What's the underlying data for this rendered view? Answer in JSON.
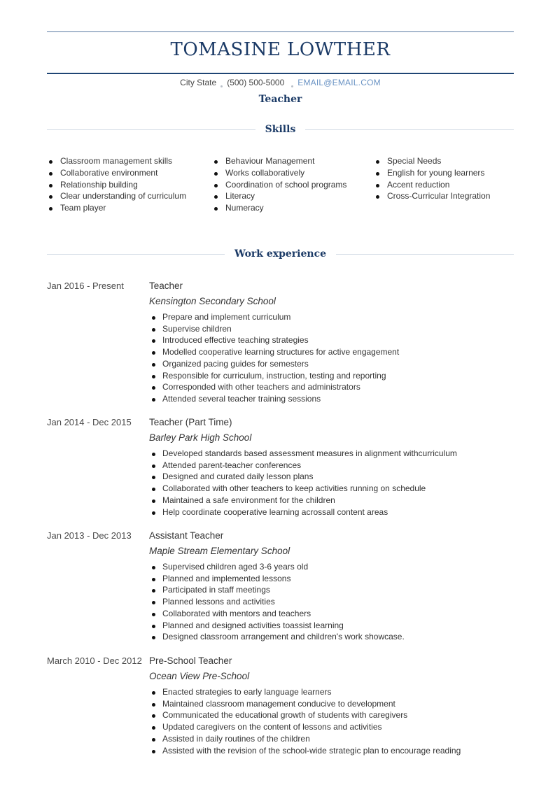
{
  "header": {
    "name": "TOMASINE LOWTHER",
    "contact": {
      "location": "City State",
      "phone": "(500) 500-5000",
      "email": "EMAIL@EMAIL.COM"
    },
    "headline": "Teacher"
  },
  "colors": {
    "accent": "#1b3a66",
    "rule_light": "#d3dbe5",
    "email_link": "#6a93c4",
    "body_text": "#333333"
  },
  "skills": {
    "title": "Skills",
    "columns": [
      [
        "Classroom management skills",
        "Collaborative environment",
        "Relationship building",
        "Clear understanding of curriculum",
        "Team player"
      ],
      [
        "Behaviour Management",
        "Works collaboratively",
        "Coordination of school programs",
        "Literacy",
        "Numeracy"
      ],
      [
        "Special Needs",
        "English for young learners",
        "Accent reduction",
        "Cross-Curricular Integration"
      ]
    ]
  },
  "experience": {
    "title": "Work experience",
    "jobs": [
      {
        "dates": "Jan 2016 - Present",
        "role": "Teacher",
        "company": "Kensington Secondary School",
        "bullets": [
          "Prepare and implement curriculum",
          "Supervise children",
          "Introduced effective teaching strategies",
          "Modelled cooperative learning structures for active engagement",
          "Organized pacing guides for semesters",
          "Responsible for curriculum,  instruction, testing and reporting",
          "Corresponded with other teachers and administrators",
          "Attended several teacher training sessions"
        ]
      },
      {
        "dates": "Jan 2014 - Dec 2015",
        "role": "Teacher (Part Time)",
        "company": "Barley Park High School",
        "bullets": [
          "Developed standards based assessment measures in alignment withcurriculum",
          "Attended parent-teacher conferences",
          "Designed and curated daily lesson plans",
          "Collaborated with other teachers to keep activities running on schedule",
          "Maintained a safe environment for the children",
          "Help coordinate cooperative learning acrossall content areas"
        ]
      },
      {
        "dates": "Jan 2013 - Dec 2013",
        "role": "Assistant Teacher",
        "company": "Maple Stream Elementary School",
        "bullets": [
          "Supervised children aged 3-6 years old",
          "Planned and implemented lessons",
          "Participated in staff meetings",
          "Planned lessons and activities",
          "Collaborated with mentors and teachers",
          "Planned and designed activities toassist learning",
          "Designed classroom arrangement and children's work showcase."
        ]
      },
      {
        "dates": "March 2010 - Dec 2012",
        "role": "Pre-School Teacher",
        "company": "Ocean View Pre-School",
        "bullets": [
          "Enacted strategies to early language learners",
          "Maintained classroom management conducive to development",
          "Communicated the educational growth of students with caregivers",
          "Updated caregivers on the content of lessons and activities",
          "Assisted in daily routines of the children",
          "Assisted with the revision of the school-wide strategic plan to encourage reading"
        ]
      }
    ]
  }
}
